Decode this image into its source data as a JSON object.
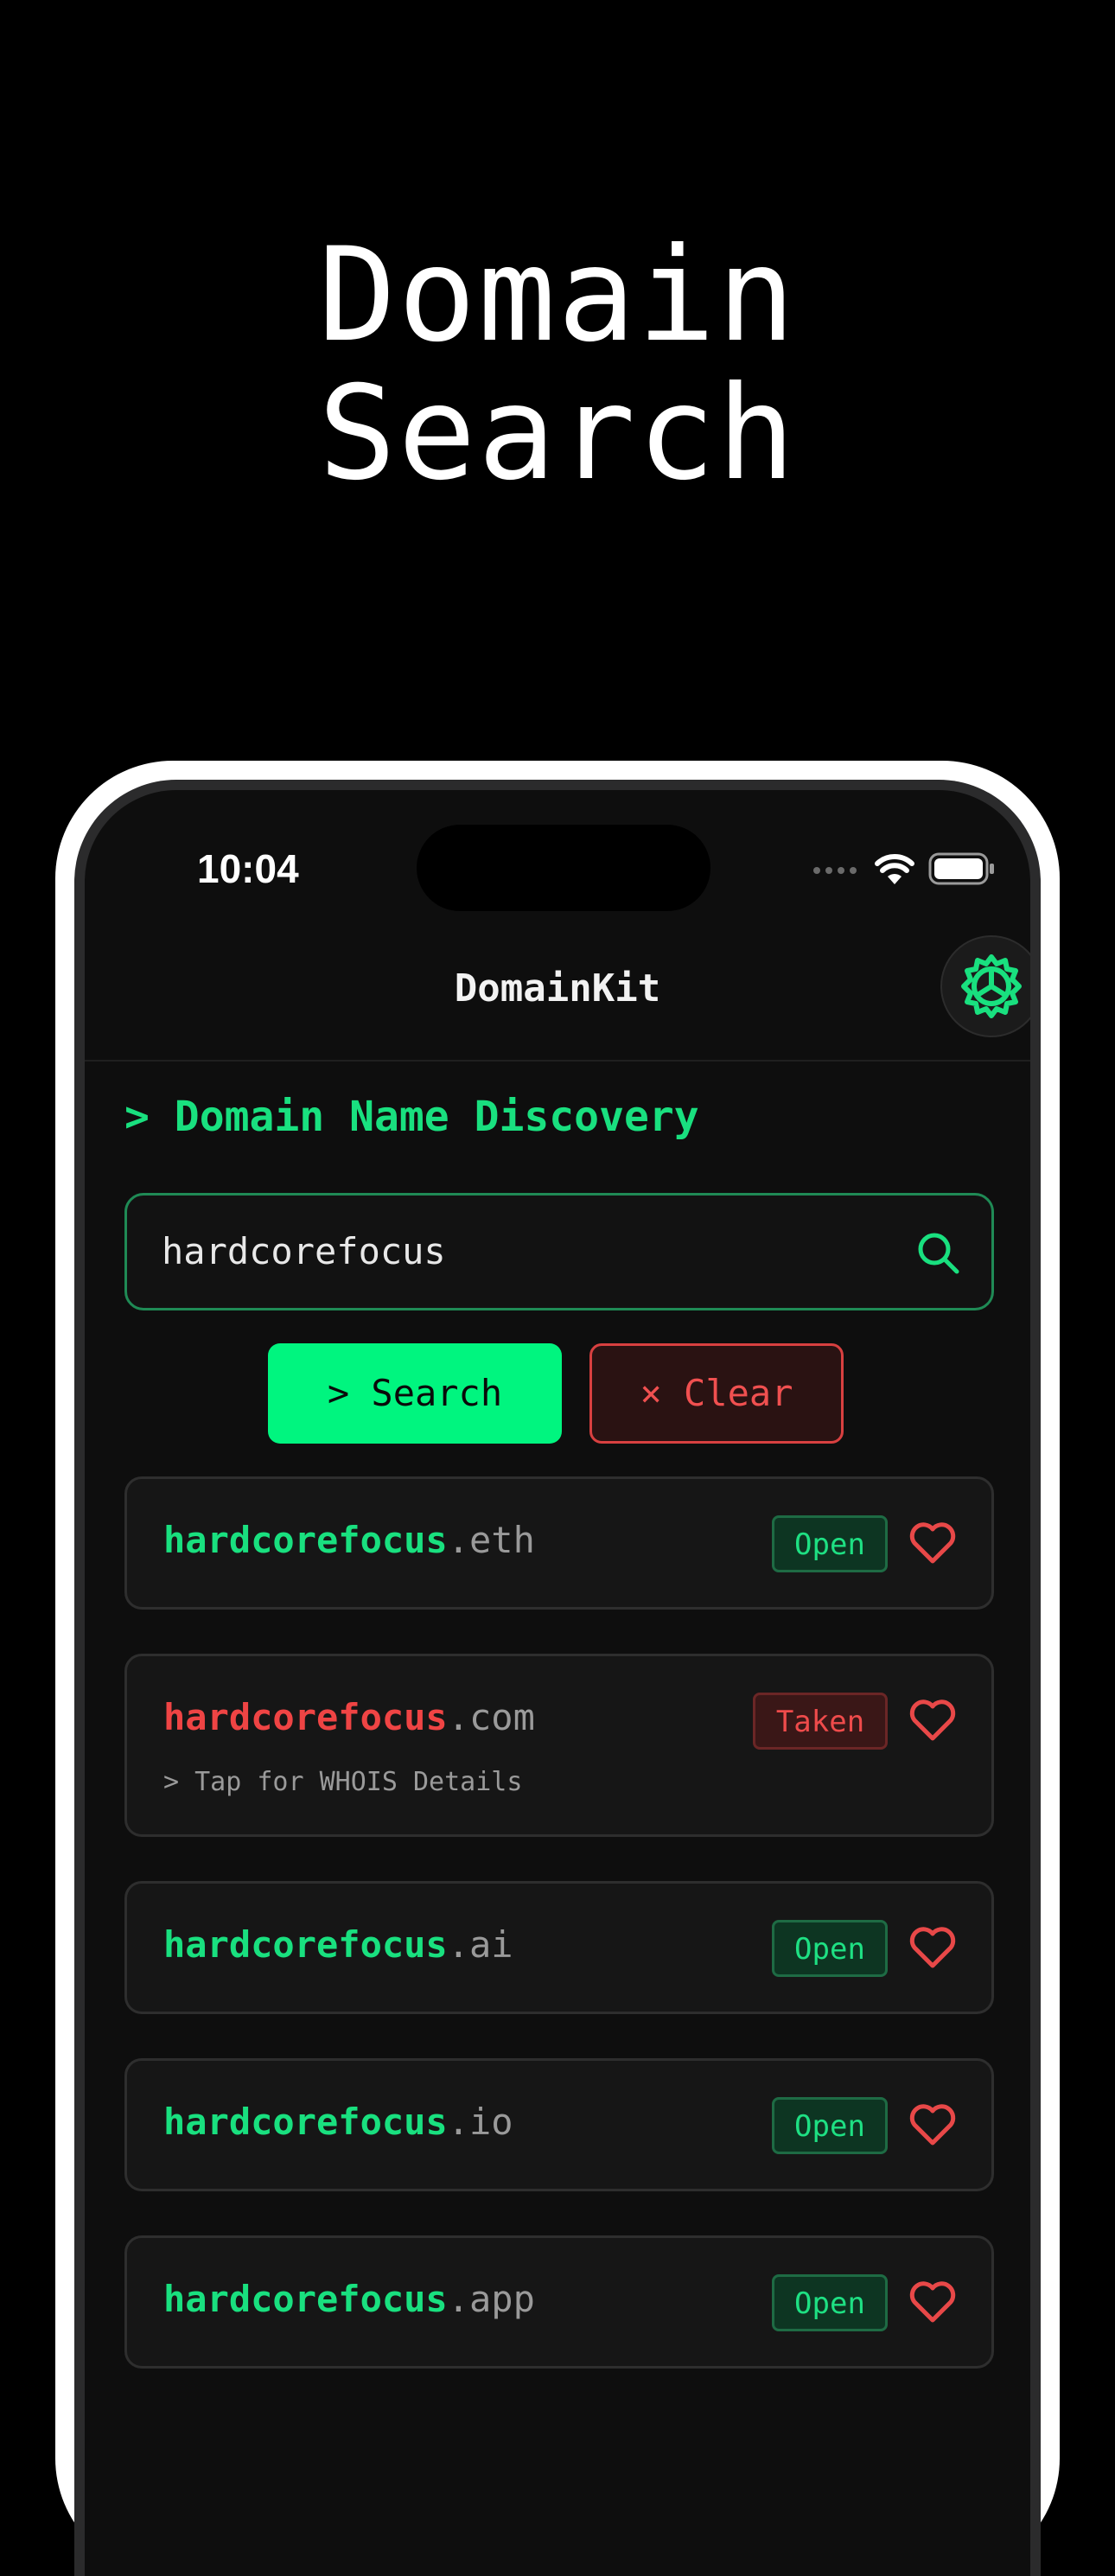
{
  "headline": {
    "line1": "Domain",
    "line2": "Search"
  },
  "status_bar": {
    "time": "10:04"
  },
  "nav": {
    "title": "DomainKit"
  },
  "section": {
    "title": "> Domain Name Discovery"
  },
  "search": {
    "value": "hardcorefocus"
  },
  "buttons": {
    "search_label": "> Search",
    "clear_label": "× Clear"
  },
  "results": [
    {
      "name": "hardcorefocus",
      "tld": ".eth",
      "status": "Open",
      "available": true
    },
    {
      "name": "hardcorefocus",
      "tld": ".com",
      "status": "Taken",
      "available": false,
      "hint": "> Tap for WHOIS Details"
    },
    {
      "name": "hardcorefocus",
      "tld": ".ai",
      "status": "Open",
      "available": true
    },
    {
      "name": "hardcorefocus",
      "tld": ".io",
      "status": "Open",
      "available": true
    },
    {
      "name": "hardcorefocus",
      "tld": ".app",
      "status": "Open",
      "available": true
    }
  ],
  "colors": {
    "accent_green": "#19e07f",
    "taken_red": "#ef4444",
    "heart_red": "#e84848",
    "background": "#000000",
    "card_background": "#161616"
  },
  "icons": [
    "gear-icon",
    "search-icon",
    "heart-icon",
    "wifi-icon",
    "battery-icon",
    "signal-icon"
  ]
}
